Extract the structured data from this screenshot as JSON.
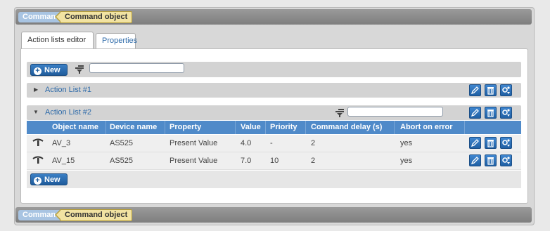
{
  "breadcrumb": {
    "root": "Commands",
    "current": "Command object"
  },
  "tabs": [
    {
      "label": "Action lists editor",
      "active": true
    },
    {
      "label": "Properties",
      "active": false
    }
  ],
  "toolbar": {
    "new_label": "New",
    "filter_value": ""
  },
  "action_lists": [
    {
      "title": "Action List #1",
      "expanded": false
    },
    {
      "title": "Action List #2",
      "expanded": true,
      "filter_value": ""
    }
  ],
  "table": {
    "columns": [
      "Object name",
      "Device name",
      "Property",
      "Value",
      "Priority",
      "Command delay (s)",
      "Abort on error"
    ],
    "rows": [
      {
        "object": "AV_3",
        "device": "AS525",
        "property": "Present Value",
        "value": "4.0",
        "priority": "-",
        "delay": "2",
        "abort": "yes"
      },
      {
        "object": "AV_15",
        "device": "AS525",
        "property": "Present Value",
        "value": "7.0",
        "priority": "10",
        "delay": "2",
        "abort": "yes"
      }
    ]
  },
  "list_new_label": "New",
  "icons": {
    "edit": "edit-pencil-icon",
    "delete": "trash-icon",
    "settings": "gear-icon",
    "filter": "filter-icon",
    "row": "command-wand-icon"
  },
  "colors": {
    "accent": "#2d6aa9",
    "header_blue": "#4f8ac9",
    "crumb_current": "#f2e3a2",
    "crumb_root": "#a8c4e2"
  }
}
